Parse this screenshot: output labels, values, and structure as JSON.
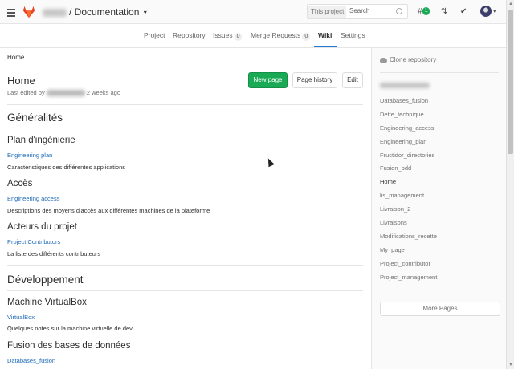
{
  "header": {
    "project_path": "/ Documentation",
    "search_scope": "This project",
    "search_placeholder": "Search",
    "todo_count": "1",
    "issues_glyph": "#",
    "mr_glyph": "⇅",
    "todos_glyph": "✔",
    "caret": "▾"
  },
  "nav": {
    "tabs": [
      {
        "label": "Project"
      },
      {
        "label": "Repository"
      },
      {
        "label": "Issues",
        "count": "0"
      },
      {
        "label": "Merge Requests",
        "count": "0"
      },
      {
        "label": "Wiki"
      },
      {
        "label": "Settings"
      }
    ],
    "active": "Wiki"
  },
  "page": {
    "breadcrumb": "Home",
    "title": "Home",
    "last_edited_prefix": "Last edited by",
    "last_edited_suffix": "2 weeks ago",
    "buttons": {
      "new_page": "New page",
      "page_history": "Page history",
      "edit": "Edit"
    }
  },
  "content": {
    "generalites": "Généralités",
    "plan_heading": "Plan d'ingénierie",
    "plan_link": "Engineering plan",
    "plan_desc": "Caractéristiques des différentes applications",
    "acces_heading": "Accès",
    "acces_link": "Engineering access",
    "acces_desc": "Descriptions des moyens d'accès aux différentes machines de la plateforme",
    "acteurs_heading": "Acteurs du projet",
    "acteurs_link": "Project Contributors",
    "acteurs_desc": "La liste des différents contributeurs",
    "developpement": "Développement",
    "vbox_heading": "Machine VirtualBox",
    "vbox_link": "VirtualBox",
    "vbox_desc": "Quelques notes sur la machine virtuelle de dev",
    "fusion_heading": "Fusion des bases de données",
    "fusion_link": "Databases_fusion"
  },
  "sidebar": {
    "clone": "Clone repository",
    "pages": [
      "Databases_fusion",
      "Dette_technique",
      "Engineering_access",
      "Engineering_plan",
      "Fructidor_directories",
      "Fusion_bdd",
      "Home",
      "lis_management",
      "Livraison_2",
      "Livraisons",
      "Modifications_recette",
      "My_page",
      "Project_contributor",
      "Project_management"
    ],
    "current": "Home",
    "more_pages": "More Pages"
  },
  "colors": {
    "accent": "#1f78d1",
    "link": "#1b69b6",
    "success": "#1aaa55"
  }
}
